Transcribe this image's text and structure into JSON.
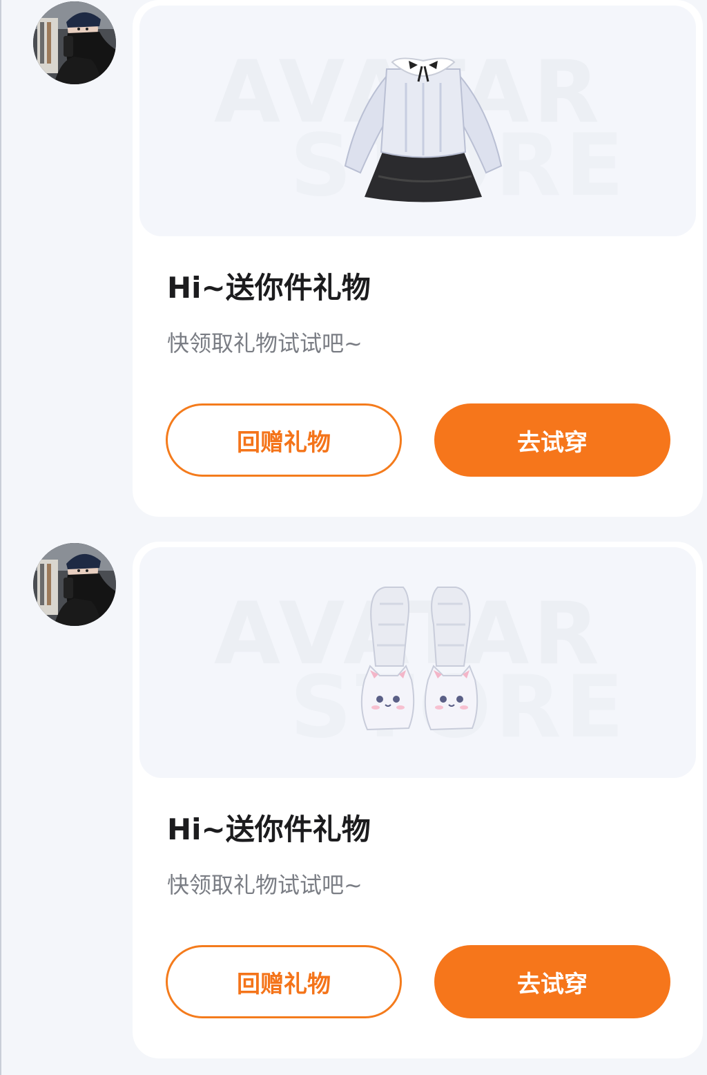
{
  "colors": {
    "accent": "#f6761b",
    "page_background": "#f4f6fa",
    "card_background": "#ffffff",
    "title": "#1c1c1e",
    "subtitle": "#7a7d84"
  },
  "messages": [
    {
      "sender_avatar": "user-avatar",
      "preview": {
        "watermark_line1": "AVATAR",
        "watermark_line2": "STORE",
        "item_icon": "sweater-skirt-outfit-icon"
      },
      "title": "Hi~送你件礼物",
      "subtitle": "快领取礼物试试吧~",
      "buttons": {
        "return_gift": "回赠礼物",
        "try_on": "去试穿"
      }
    },
    {
      "sender_avatar": "user-avatar",
      "preview": {
        "watermark_line1": "AVATAR",
        "watermark_line2": "STORE",
        "item_icon": "cat-slippers-leg-warmers-icon"
      },
      "title": "Hi~送你件礼物",
      "subtitle": "快领取礼物试试吧~",
      "buttons": {
        "return_gift": "回赠礼物",
        "try_on": "去试穿"
      }
    }
  ]
}
